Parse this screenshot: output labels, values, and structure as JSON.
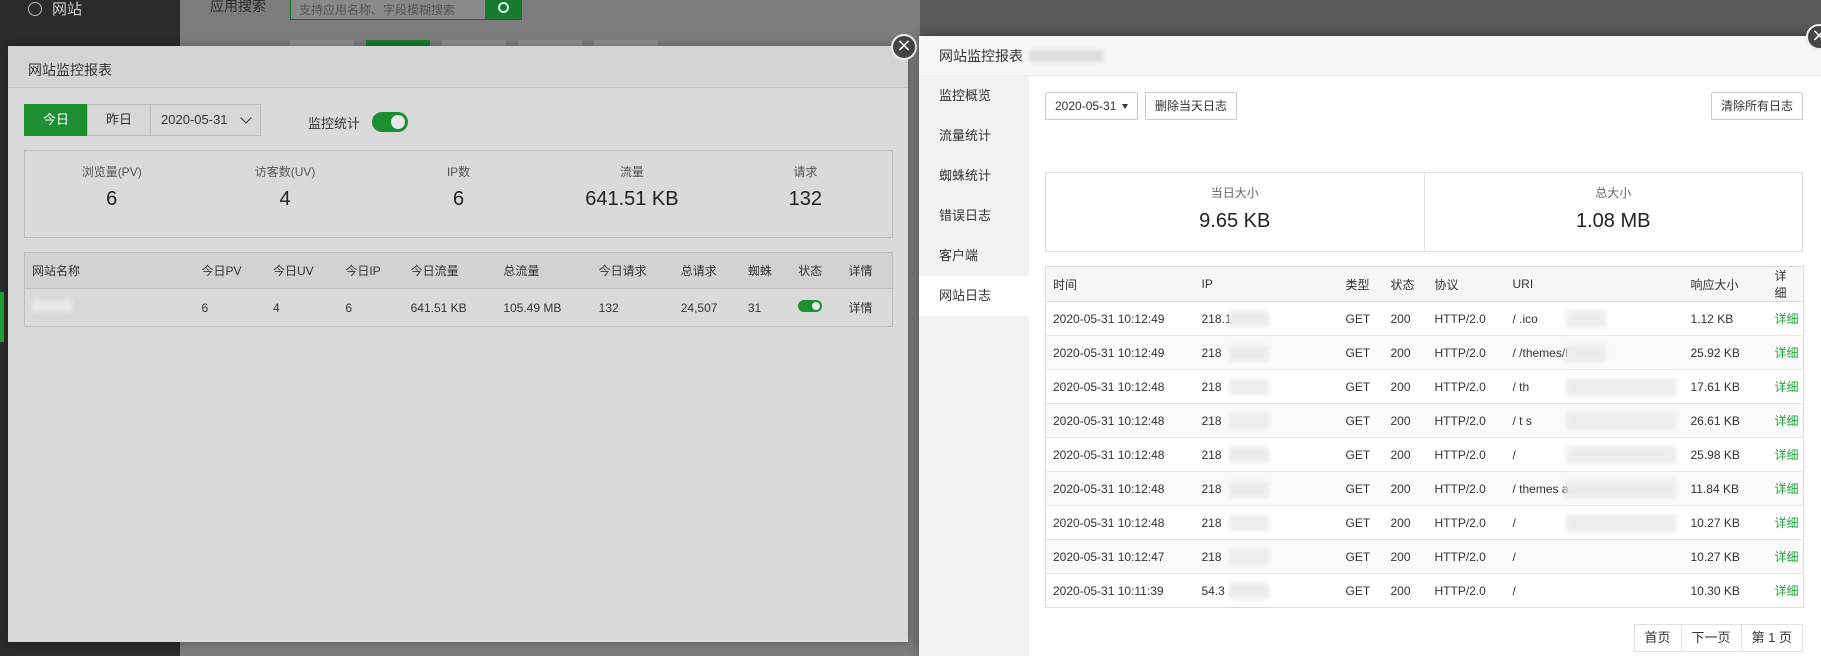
{
  "background": {
    "nav_website": "网站",
    "app_search_title": "应用搜索",
    "search_placeholder": "支持应用名称、字段模糊搜索"
  },
  "left_modal": {
    "title": "网站监控报表",
    "today": "今日",
    "yesterday": "昨日",
    "date": "2020-05-31",
    "monitor_label": "监控统计",
    "stats": [
      {
        "label": "浏览量(PV)",
        "value": "6"
      },
      {
        "label": "访客数(UV)",
        "value": "4"
      },
      {
        "label": "IP数",
        "value": "6"
      },
      {
        "label": "流量",
        "value": "641.51 KB"
      },
      {
        "label": "请求",
        "value": "132"
      }
    ],
    "table": {
      "headers": [
        "网站名称",
        "今日PV",
        "今日UV",
        "今日IP",
        "今日流量",
        "总流量",
        "今日请求",
        "总请求",
        "蜘蛛",
        "状态",
        "详情"
      ],
      "row": {
        "pv": "6",
        "uv": "4",
        "ip": "6",
        "traffic": "641.51 KB",
        "total_traffic": "105.49 MB",
        "req": "132",
        "total_req": "24,507",
        "spider": "31",
        "detail": "详情"
      }
    }
  },
  "right_modal": {
    "title": "网站监控报表",
    "side": [
      "监控概览",
      "流量统计",
      "蜘蛛统计",
      "错误日志",
      "客户端",
      "网站日志"
    ],
    "date": "2020-05-31",
    "delete_today": "删除当天日志",
    "clear_all": "清除所有日志",
    "sizes": [
      {
        "label": "当日大小",
        "value": "9.65 KB"
      },
      {
        "label": "总大小",
        "value": "1.08 MB"
      }
    ],
    "log_headers": [
      "时间",
      "IP",
      "类型",
      "状态",
      "协议",
      "URI",
      "响应大小",
      "详细"
    ],
    "logs": [
      {
        "time": "2020-05-31 10:12:49",
        "ip": "218.1",
        "type": "GET",
        "status": "200",
        "proto": "HTTP/2.0",
        "uri": "/     .ico",
        "size": "1.12 KB",
        "detail": "详细"
      },
      {
        "time": "2020-05-31 10:12:49",
        "ip": "218",
        "type": "GET",
        "status": "200",
        "proto": "HTTP/2.0",
        "uri": "/    /themes/l     em...",
        "size": "25.92 KB",
        "detail": "详细"
      },
      {
        "time": "2020-05-31 10:12:48",
        "ip": "218",
        "type": "GET",
        "status": "200",
        "proto": "HTTP/2.0",
        "uri": "/    th",
        "size": "17.61 KB",
        "detail": "详细"
      },
      {
        "time": "2020-05-31 10:12:48",
        "ip": "218",
        "type": "GET",
        "status": "200",
        "proto": "HTTP/2.0",
        "uri": "/    t      s",
        "size": "26.61 KB",
        "detail": "详细"
      },
      {
        "time": "2020-05-31 10:12:48",
        "ip": "218",
        "type": "GET",
        "status": "200",
        "proto": "HTTP/2.0",
        "uri": "/",
        "size": "25.98 KB",
        "detail": "详细"
      },
      {
        "time": "2020-05-31 10:12:48",
        "ip": "218",
        "type": "GET",
        "status": "200",
        "proto": "HTTP/2.0",
        "uri": "/    themes   andsc   ..",
        "size": "11.84 KB",
        "detail": "详细"
      },
      {
        "time": "2020-05-31 10:12:48",
        "ip": "218",
        "type": "GET",
        "status": "200",
        "proto": "HTTP/2.0",
        "uri": "/",
        "size": "10.27 KB",
        "detail": "详细"
      },
      {
        "time": "2020-05-31 10:12:47",
        "ip": "218",
        "type": "GET",
        "status": "200",
        "proto": "HTTP/2.0",
        "uri": "/",
        "size": "10.27 KB",
        "detail": "详细"
      },
      {
        "time": "2020-05-31 10:11:39",
        "ip": "54.3",
        "type": "GET",
        "status": "200",
        "proto": "HTTP/2.0",
        "uri": "/",
        "size": "10.30 KB",
        "detail": "详细"
      }
    ],
    "pager": [
      "首页",
      "下一页",
      "第 1 页"
    ]
  },
  "colors": {
    "accent": "#20a53a",
    "overlay": "#7d7d7d"
  }
}
